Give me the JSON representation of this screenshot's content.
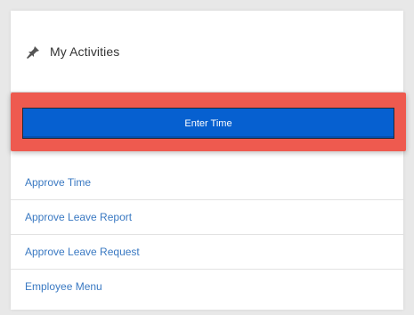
{
  "panel": {
    "title": "My Activities",
    "title_icon": "pin-icon"
  },
  "primary_action": {
    "label": "Enter Time"
  },
  "menu": {
    "items": [
      {
        "label": "Approve Time"
      },
      {
        "label": "Approve Leave Report"
      },
      {
        "label": "Approve Leave Request"
      },
      {
        "label": "Employee Menu"
      }
    ]
  },
  "colors": {
    "button_blue": "#0660d0",
    "highlight_red": "#ee5a4f",
    "link_blue": "#3a79c2"
  }
}
